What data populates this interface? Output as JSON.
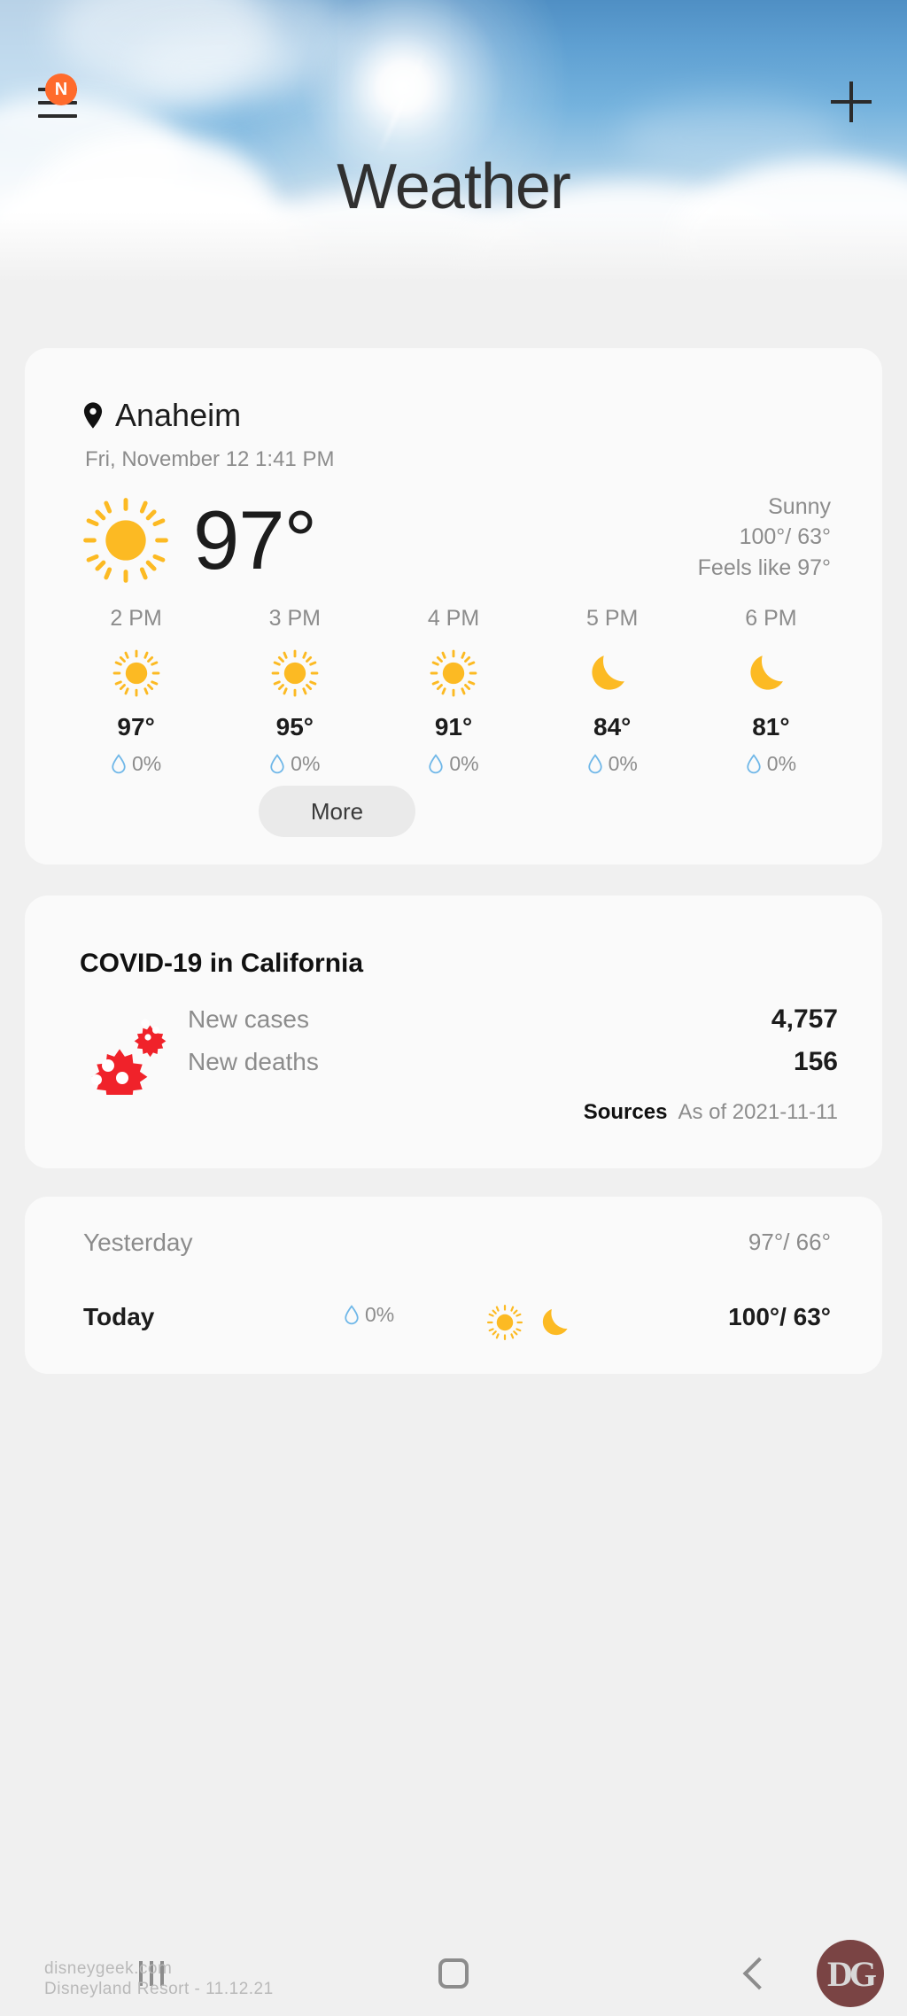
{
  "header": {
    "title": "Weather",
    "menu_badge": "N",
    "menu_icon": "hamburger-menu-icon",
    "add_icon": "plus-icon"
  },
  "current": {
    "location": "Anaheim",
    "location_icon": "location-pin-icon",
    "datetime": "Fri, November 12 1:41 PM",
    "temperature": "97°",
    "icon": "sun-icon",
    "condition": "Sunny",
    "high_low": "100°/ 63°",
    "feels_like": "Feels like 97°",
    "more_label": "More"
  },
  "hourly": [
    {
      "time": "2 PM",
      "icon": "sun-icon",
      "temp": "97°",
      "pop": "0%"
    },
    {
      "time": "3 PM",
      "icon": "sun-icon",
      "temp": "95°",
      "pop": "0%"
    },
    {
      "time": "4 PM",
      "icon": "sun-icon",
      "temp": "91°",
      "pop": "0%"
    },
    {
      "time": "5 PM",
      "icon": "moon-icon",
      "temp": "84°",
      "pop": "0%"
    },
    {
      "time": "6 PM",
      "icon": "moon-icon",
      "temp": "81°",
      "pop": "0%"
    }
  ],
  "covid": {
    "title": "COVID-19 in California",
    "icon": "virus-icon",
    "rows": [
      {
        "label": "New cases",
        "value": "4,757"
      },
      {
        "label": "New deaths",
        "value": "156"
      }
    ],
    "sources_label": "Sources",
    "as_of": "As of 2021-11-11"
  },
  "daily": [
    {
      "day": "Yesterday",
      "pop": "",
      "temps": "97°/ 66°",
      "icons": []
    },
    {
      "day": "Today",
      "pop": "0%",
      "temps": "100°/ 63°",
      "icons": [
        "sun-icon",
        "moon-icon"
      ]
    }
  ],
  "navbar": {
    "recents": "recents-icon",
    "home": "home-icon",
    "back": "back-icon"
  },
  "watermark": {
    "logo": "DG",
    "line1": "disneygeek.com",
    "line2": "Disneyland Resort - 11.12.21"
  },
  "colors": {
    "accent_orange": "#ff6b2c",
    "sun_yellow": "#fcba23",
    "virus_red": "#f0222a",
    "water_blue": "#6fb7e8",
    "card_bg": "#fafafa",
    "page_bg": "#f0f0f0"
  }
}
